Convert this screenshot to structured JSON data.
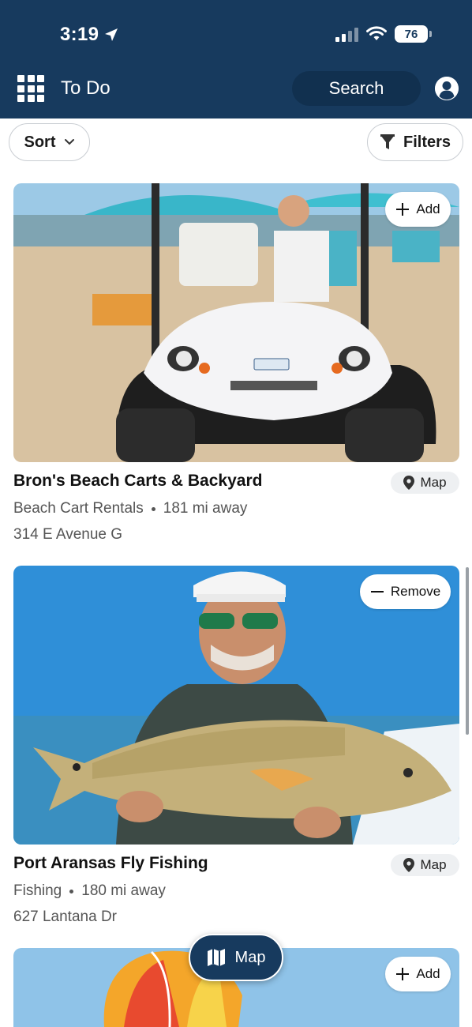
{
  "status_bar": {
    "time": "3:19",
    "battery": "76"
  },
  "header": {
    "title": "To Do",
    "search_label": "Search"
  },
  "toolbar": {
    "sort_label": "Sort",
    "filters_label": "Filters"
  },
  "listings": [
    {
      "title": "Bron's Beach Carts & Backyard",
      "category": "Beach Cart Rentals",
      "distance": "181 mi away",
      "address": "314 E Avenue G",
      "action_label": "Add",
      "map_label": "Map",
      "image_desc": "woman driving beach cart"
    },
    {
      "title": "Port Aransas Fly Fishing",
      "category": "Fishing",
      "distance": "180 mi away",
      "address": "627 Lantana Dr",
      "action_label": "Remove",
      "map_label": "Map",
      "image_desc": "man holding redfish"
    },
    {
      "action_label": "Add",
      "image_desc": "parasail"
    }
  ],
  "map_button": {
    "label": "Map"
  },
  "colors": {
    "header_bg": "#173a5e",
    "search_bg": "#11304f"
  }
}
